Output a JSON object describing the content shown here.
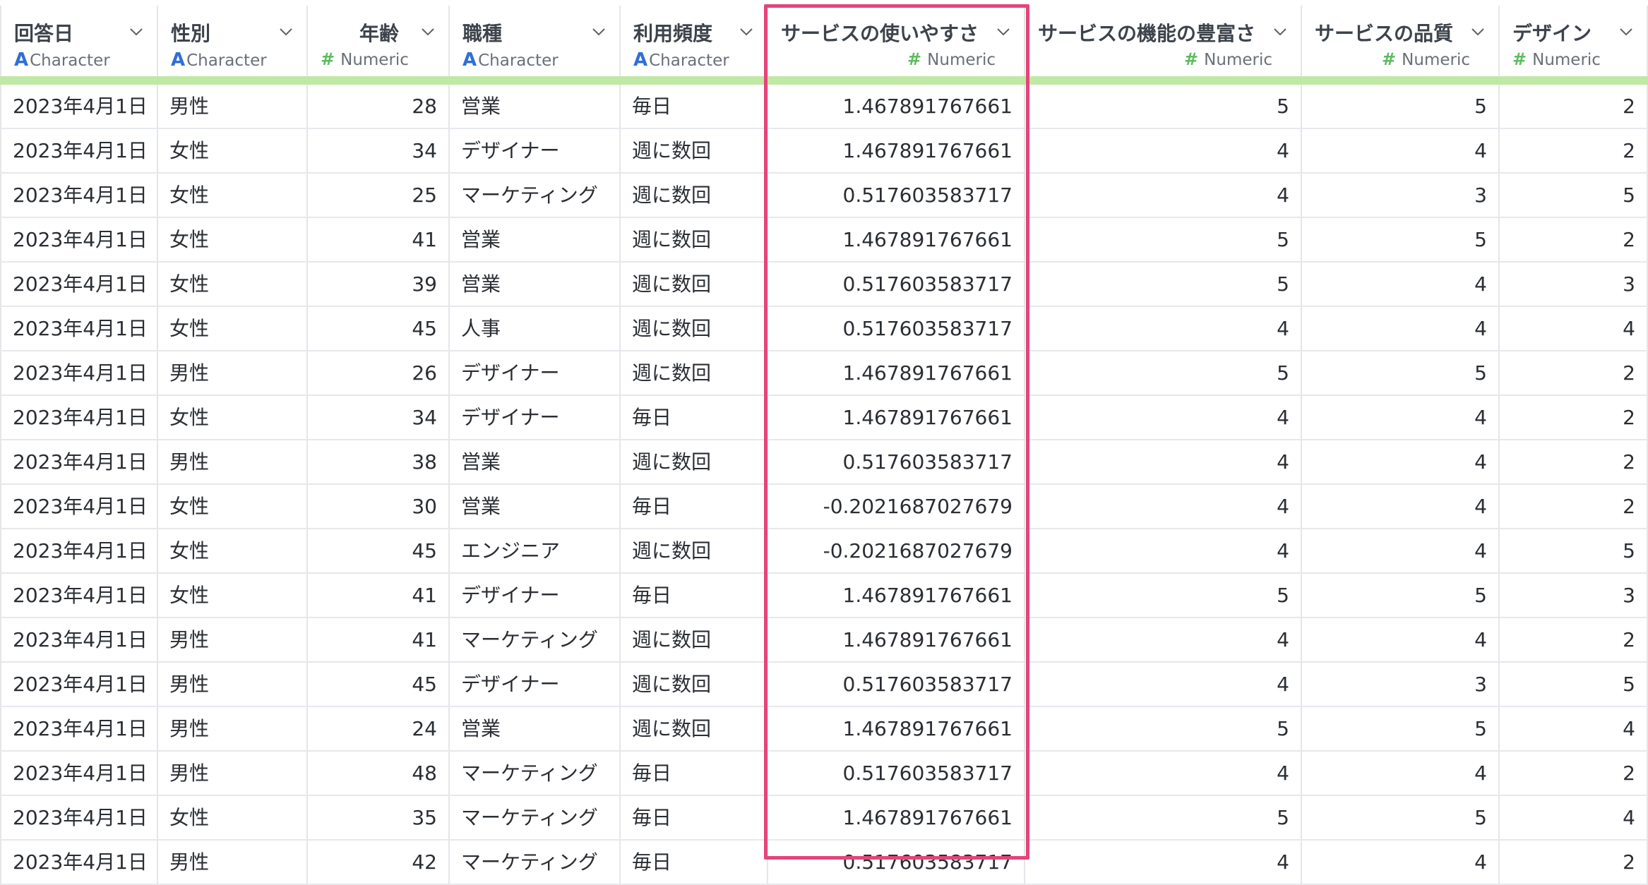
{
  "accent_colors": {
    "highlight": "#e4457a",
    "header_underline": "#bfe9a4",
    "type_character_icon": "#2f6fd6",
    "type_numeric_icon": "#5cbc5f"
  },
  "columns": [
    {
      "title": "回答日",
      "type_label": "Character",
      "type_icon": "A",
      "kind": "character"
    },
    {
      "title": "性別",
      "type_label": "Character",
      "type_icon": "A",
      "kind": "character"
    },
    {
      "title": "年齢",
      "type_label": "Numeric",
      "type_icon": "#",
      "kind": "numeric"
    },
    {
      "title": "職種",
      "type_label": "Character",
      "type_icon": "A",
      "kind": "character"
    },
    {
      "title": "利用頻度",
      "type_label": "Character",
      "type_icon": "A",
      "kind": "character"
    },
    {
      "title": "サービスの使いやすさ",
      "type_label": "Numeric",
      "type_icon": "#",
      "kind": "numeric",
      "selected": true
    },
    {
      "title": "サービスの機能の豊富さ",
      "type_label": "Numeric",
      "type_icon": "#",
      "kind": "numeric"
    },
    {
      "title": "サービスの品質",
      "type_label": "Numeric",
      "type_icon": "#",
      "kind": "numeric"
    },
    {
      "title": "デザイン",
      "type_label": "Numeric",
      "type_icon": "#",
      "kind": "numeric"
    }
  ],
  "rows": [
    [
      "2023年4月1日",
      "男性",
      "28",
      "営業",
      "毎日",
      "1.467891767661",
      "5",
      "5",
      "2"
    ],
    [
      "2023年4月1日",
      "女性",
      "34",
      "デザイナー",
      "週に数回",
      "1.467891767661",
      "4",
      "4",
      "2"
    ],
    [
      "2023年4月1日",
      "女性",
      "25",
      "マーケティング",
      "週に数回",
      "0.517603583717",
      "4",
      "3",
      "5"
    ],
    [
      "2023年4月1日",
      "女性",
      "41",
      "営業",
      "週に数回",
      "1.467891767661",
      "5",
      "5",
      "2"
    ],
    [
      "2023年4月1日",
      "女性",
      "39",
      "営業",
      "週に数回",
      "0.517603583717",
      "5",
      "4",
      "3"
    ],
    [
      "2023年4月1日",
      "女性",
      "45",
      "人事",
      "週に数回",
      "0.517603583717",
      "4",
      "4",
      "4"
    ],
    [
      "2023年4月1日",
      "男性",
      "26",
      "デザイナー",
      "週に数回",
      "1.467891767661",
      "5",
      "5",
      "2"
    ],
    [
      "2023年4月1日",
      "女性",
      "34",
      "デザイナー",
      "毎日",
      "1.467891767661",
      "4",
      "4",
      "2"
    ],
    [
      "2023年4月1日",
      "男性",
      "38",
      "営業",
      "週に数回",
      "0.517603583717",
      "4",
      "4",
      "2"
    ],
    [
      "2023年4月1日",
      "女性",
      "30",
      "営業",
      "毎日",
      "-0.2021687027679",
      "4",
      "4",
      "2"
    ],
    [
      "2023年4月1日",
      "女性",
      "45",
      "エンジニア",
      "週に数回",
      "-0.2021687027679",
      "4",
      "4",
      "5"
    ],
    [
      "2023年4月1日",
      "女性",
      "41",
      "デザイナー",
      "毎日",
      "1.467891767661",
      "5",
      "5",
      "3"
    ],
    [
      "2023年4月1日",
      "男性",
      "41",
      "マーケティング",
      "週に数回",
      "1.467891767661",
      "4",
      "4",
      "2"
    ],
    [
      "2023年4月1日",
      "男性",
      "45",
      "デザイナー",
      "週に数回",
      "0.517603583717",
      "4",
      "3",
      "5"
    ],
    [
      "2023年4月1日",
      "男性",
      "24",
      "営業",
      "週に数回",
      "1.467891767661",
      "5",
      "5",
      "4"
    ],
    [
      "2023年4月1日",
      "男性",
      "48",
      "マーケティング",
      "毎日",
      "0.517603583717",
      "4",
      "4",
      "2"
    ],
    [
      "2023年4月1日",
      "女性",
      "35",
      "マーケティング",
      "毎日",
      "1.467891767661",
      "5",
      "5",
      "4"
    ],
    [
      "2023年4月1日",
      "男性",
      "42",
      "マーケティング",
      "毎日",
      "0.517603583717",
      "4",
      "4",
      "2"
    ]
  ]
}
